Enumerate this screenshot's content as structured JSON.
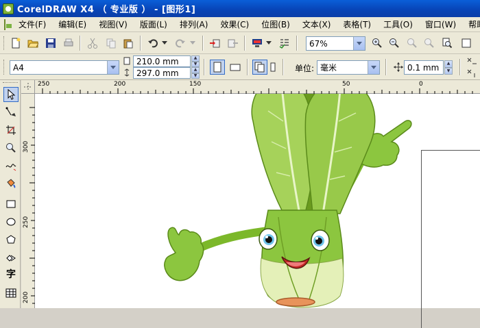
{
  "window": {
    "title": "CorelDRAW X4 （ 专业版 ） - [图形1]"
  },
  "menu": {
    "items": [
      "文件(F)",
      "编辑(E)",
      "视图(V)",
      "版面(L)",
      "排列(A)",
      "效果(C)",
      "位图(B)",
      "文本(X)",
      "表格(T)",
      "工具(O)",
      "窗口(W)",
      "帮助(H)"
    ]
  },
  "toolbar": {
    "zoom_value": "67%"
  },
  "property_bar": {
    "paper_size": "A4",
    "width": "210.0 mm",
    "height": "297.0 mm",
    "units_label": "单位:",
    "units_value": "毫米",
    "nudge_value": "0.1 mm"
  },
  "rulers": {
    "horizontal_labels": [
      "250",
      "200",
      "150",
      "50",
      "0"
    ],
    "vertical_labels": [
      "300",
      "250",
      "200"
    ]
  },
  "icons": {
    "app": "coreldraw-logo-icon",
    "document": "document-icon"
  },
  "colors": {
    "titlebar": "#0a4fc8",
    "chrome": "#ece9d8",
    "lettuce_light": "#b8d96a",
    "lettuce_dark": "#6a9a1e"
  }
}
